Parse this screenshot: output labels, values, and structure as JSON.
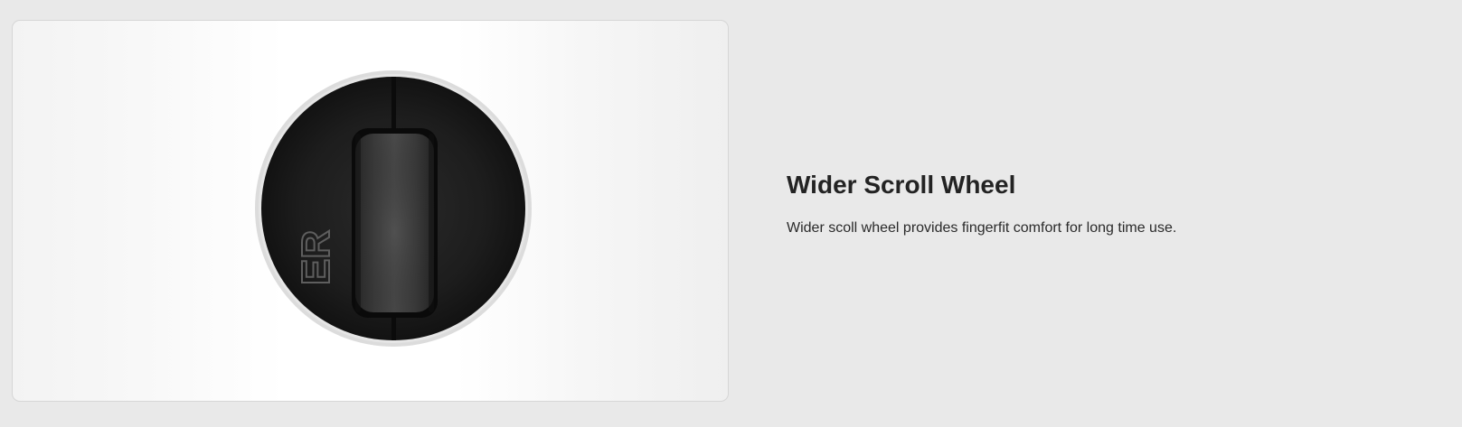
{
  "feature": {
    "title": "Wider Scroll Wheel",
    "description": "Wider scoll wheel provides fingerfit comfort for long time use."
  },
  "image": {
    "subject": "mouse-scroll-wheel-closeup",
    "embossed_text": "ER"
  },
  "colors": {
    "page_background": "#e9e9e9",
    "card_border": "#d6d6d6",
    "mouse_body": "#1c1c1c",
    "text": "#232323"
  }
}
